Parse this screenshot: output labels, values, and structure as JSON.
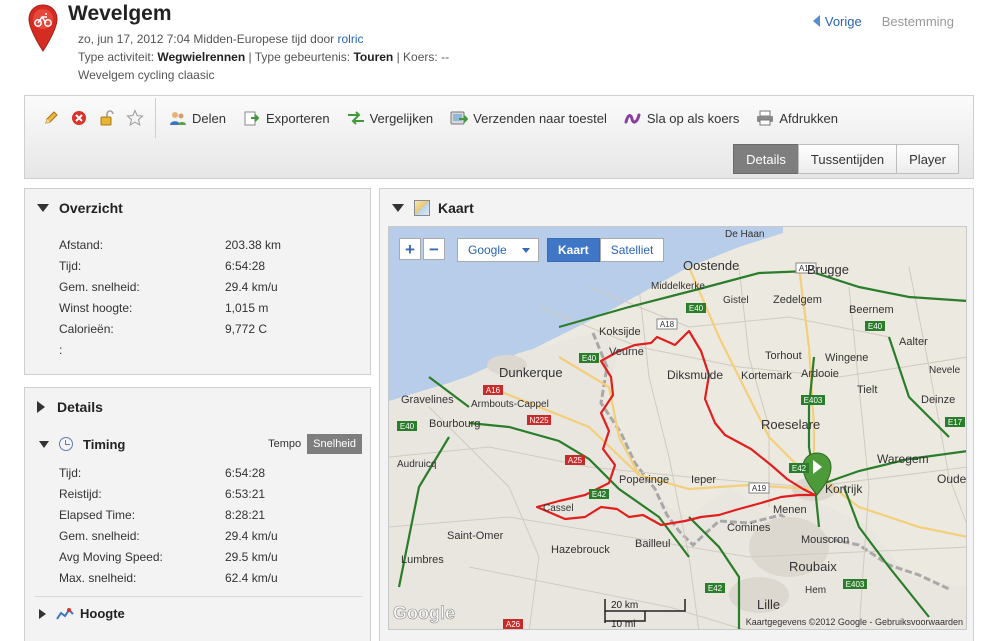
{
  "header": {
    "title": "Wevelgem",
    "date_line": "zo, jun 17, 2012 7:04 Midden-Europese tijd door ",
    "author": "rolric",
    "activity_prefix": "Type activiteit: ",
    "activity_type": "Wegwielrennen",
    "event_prefix": " | Type gebeurtenis: ",
    "event_type": "Touren",
    "course_text": " | Koers: --",
    "description": "Wevelgem cycling claasic",
    "prev_label": "Vorige",
    "next_label": "Bestemming"
  },
  "toolbar": {
    "share": "Delen",
    "export": "Exporteren",
    "compare": "Vergelijken",
    "send": "Verzenden naar toestel",
    "save_course": "Sla op als koers",
    "print": "Afdrukken",
    "tabs": [
      "Details",
      "Tussentijden",
      "Player"
    ],
    "active_tab": "Details"
  },
  "overview": {
    "title": "Overzicht",
    "rows": [
      {
        "label": "Afstand:",
        "value": "203.38 km"
      },
      {
        "label": "Tijd:",
        "value": "6:54:28"
      },
      {
        "label": "Gem. snelheid:",
        "value": "29.4 km/u"
      },
      {
        "label": "Winst hoogte:",
        "value": "1,015 m"
      },
      {
        "label": "Calorieën:",
        "value": "9,772 C"
      },
      {
        "label": ":",
        "value": ""
      }
    ]
  },
  "details": {
    "title": "Details",
    "timing_title": "Timing",
    "mode_tempo": "Tempo",
    "mode_speed": "Snelheid",
    "rows": [
      {
        "label": "Tijd:",
        "value": "6:54:28"
      },
      {
        "label": "Reistijd:",
        "value": "6:53:21"
      },
      {
        "label": "Elapsed Time:",
        "value": "8:28:21"
      },
      {
        "label": "Gem. snelheid:",
        "value": "29.4 km/u"
      },
      {
        "label": "Avg Moving Speed:",
        "value": "29.5 km/u"
      },
      {
        "label": "Max. snelheid:",
        "value": "62.4 km/u"
      }
    ],
    "height_title": "Hoogte"
  },
  "map": {
    "title": "Kaart",
    "provider": "Google",
    "type_map": "Kaart",
    "type_satellite": "Satelliet",
    "scale_km": "20 km",
    "scale_mi": "10 mi",
    "attribution": "Kaartgegevens ©2012 Google - Gebruiksvoorwaarden",
    "logo": "Google",
    "places": {
      "dehaan": "De Haan",
      "oostende": "Oostende",
      "brugge": "Brugge",
      "middelkerke": "Middelkerke",
      "gistel": "Gistel",
      "zedelgem": "Zedelgem",
      "beernem": "Beernem",
      "koksijde": "Koksijde",
      "veurne": "Veurne",
      "aalter": "Aalter",
      "torhout": "Torhout",
      "wingene": "Wingene",
      "dunkerque": "Dunkerque",
      "diksmuide": "Diksmuide",
      "kortemark": "Kortemark",
      "ardooie": "Ardooie",
      "gravelines": "Gravelines",
      "armbouts": "Armbouts-Cappel",
      "tielt": "Tielt",
      "nevele": "Nevele",
      "bourbourg": "Bourbourg",
      "deinze": "Deinze",
      "roeselare": "Roeselare",
      "audruicq": "Audruicq",
      "waregem": "Waregem",
      "poperinge": "Poperinge",
      "ieper": "Ieper",
      "kortrijk": "Kortrijk",
      "oudenaarde": "Oude",
      "cassel": "Cassel",
      "menen": "Menen",
      "comines": "Comines",
      "saintomer": "Saint-Omer",
      "hazebrouck": "Hazebrouck",
      "bailleul": "Bailleul",
      "mouscron": "Mouscron",
      "roubaix": "Roubaix",
      "lumbres": "Lumbres",
      "lille": "Lille",
      "hem": "Hem"
    },
    "roads": [
      "A10",
      "E40",
      "A18",
      "E40",
      "E40",
      "A16",
      "N225",
      "E40",
      "E403",
      "E17",
      "A25",
      "E42",
      "A19",
      "E42",
      "A26",
      "E42",
      "E403"
    ]
  },
  "colors": {
    "route": "#e21f1f",
    "link": "#2a64b2",
    "sea": "#b4cbe8",
    "land": "#edeae2",
    "start_marker": "#4d9a3a"
  }
}
